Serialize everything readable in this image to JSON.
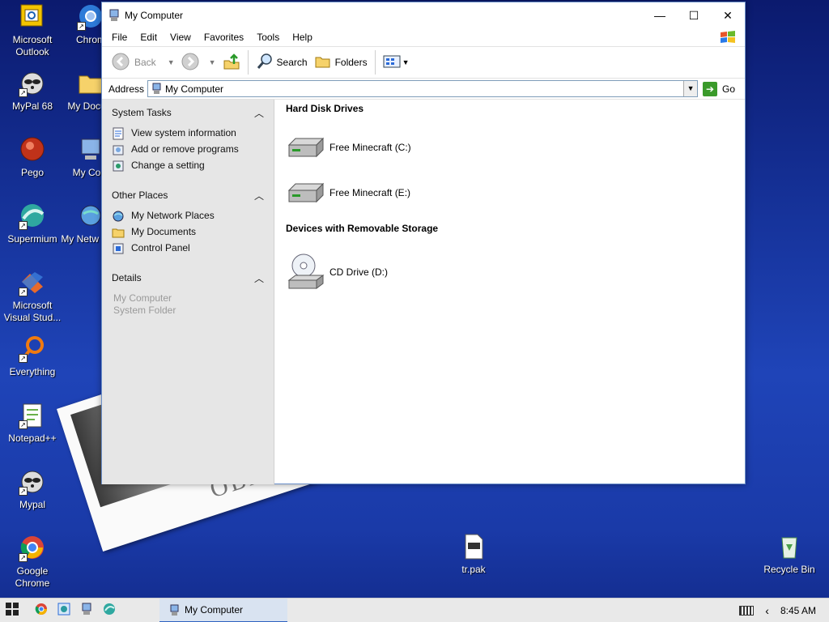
{
  "desktop": {
    "icons": [
      {
        "label": "Microsoft Outlook"
      },
      {
        "label": "MyPal 68"
      },
      {
        "label": "Pego"
      },
      {
        "label": "Supermium"
      },
      {
        "label": "Microsoft Visual Stud..."
      },
      {
        "label": "Everything"
      },
      {
        "label": "Notepad++"
      },
      {
        "label": "Mypal"
      },
      {
        "label": "Google Chrome"
      },
      {
        "label": "Chrom"
      },
      {
        "label": "My Docum"
      },
      {
        "label": "My Com"
      },
      {
        "label": "My Netw Plac"
      },
      {
        "label": "tr.pak"
      },
      {
        "label": "Recycle Bin"
      }
    ],
    "polaroid_caption": "OBAMA"
  },
  "window": {
    "title": "My Computer",
    "caption_buttons": {
      "minimize": "—",
      "maximize": "☐",
      "close": "✕"
    },
    "menu": [
      "File",
      "Edit",
      "View",
      "Favorites",
      "Tools",
      "Help"
    ],
    "toolbar": {
      "back": "Back",
      "search": "Search",
      "folders": "Folders"
    },
    "address": {
      "label": "Address",
      "value": "My Computer",
      "go": "Go"
    },
    "taskpane": {
      "system_tasks": {
        "title": "System Tasks",
        "items": [
          "View system information",
          "Add or remove programs",
          "Change a setting"
        ]
      },
      "other_places": {
        "title": "Other Places",
        "items": [
          "My Network Places",
          "My Documents",
          "Control Panel"
        ]
      },
      "details": {
        "title": "Details",
        "lines": [
          "My Computer",
          "System Folder"
        ]
      }
    },
    "main": {
      "hard_disk_title": "Hard Disk Drives",
      "hard_disks": [
        "Free Minecraft (C:)",
        "Free Minecraft (E:)"
      ],
      "removable_title": "Devices with Removable Storage",
      "removable": [
        "CD Drive (D:)"
      ]
    }
  },
  "taskbar": {
    "active_task": "My Computer",
    "time": "8:45 AM"
  },
  "colors": {
    "desktop_blue": "#1f44b8",
    "taskpane_gray": "#e6e6e6",
    "taskbar_gray": "#e9e9e9",
    "active_task_underline": "#2f62c0"
  }
}
